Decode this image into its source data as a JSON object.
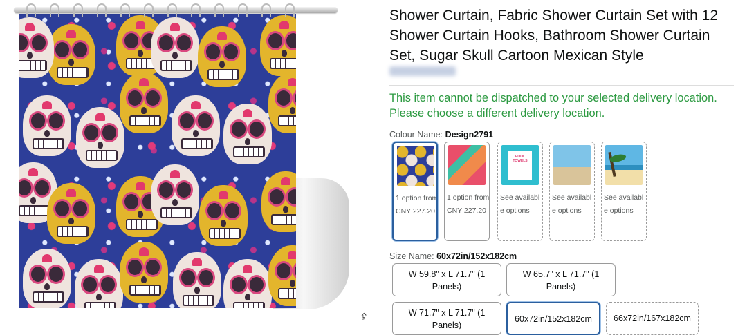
{
  "product": {
    "title": "Shower Curtain, Fabric Shower Curtain Set with 12 Shower Curtain Hooks, Bathroom Shower Curtain Set, Sugar Skull Cartoon Mexican Style",
    "delivery_message": "This item cannot be dispatched to your selected delivery location. Please choose a different delivery location."
  },
  "colour": {
    "label": "Colour Name:",
    "selected": "Design2791",
    "options": [
      {
        "text": "1 option from CNY 227.20",
        "thumb_icon": "sugar-skull-pattern"
      },
      {
        "text": "1 option from CNY 227.20",
        "thumb_icon": "flamingo-pattern"
      },
      {
        "text": "See available options",
        "thumb_icon": "poster-print",
        "poster_text": "POOL TOWELS"
      },
      {
        "text": "See available options",
        "thumb_icon": "beach-scene"
      },
      {
        "text": "See available options",
        "thumb_icon": "palm-beach"
      }
    ]
  },
  "size": {
    "label": "Size Name:",
    "selected": "60x72in/152x182cm",
    "options": [
      "W 59.8\" x L 71.7\" (1 Panels)",
      "W 65.7\" x L 71.7\" (1 Panels)",
      "W 71.7\" x L 71.7\" (1 Panels)",
      "60x72in/152x182cm",
      "66x72in/167x182cm"
    ]
  },
  "icons": {
    "share": "share-icon"
  },
  "colors": {
    "delivery_text": "#2c9a41",
    "selected_border": "#2b5f9e",
    "curtain_bg": "#2d3e99"
  }
}
